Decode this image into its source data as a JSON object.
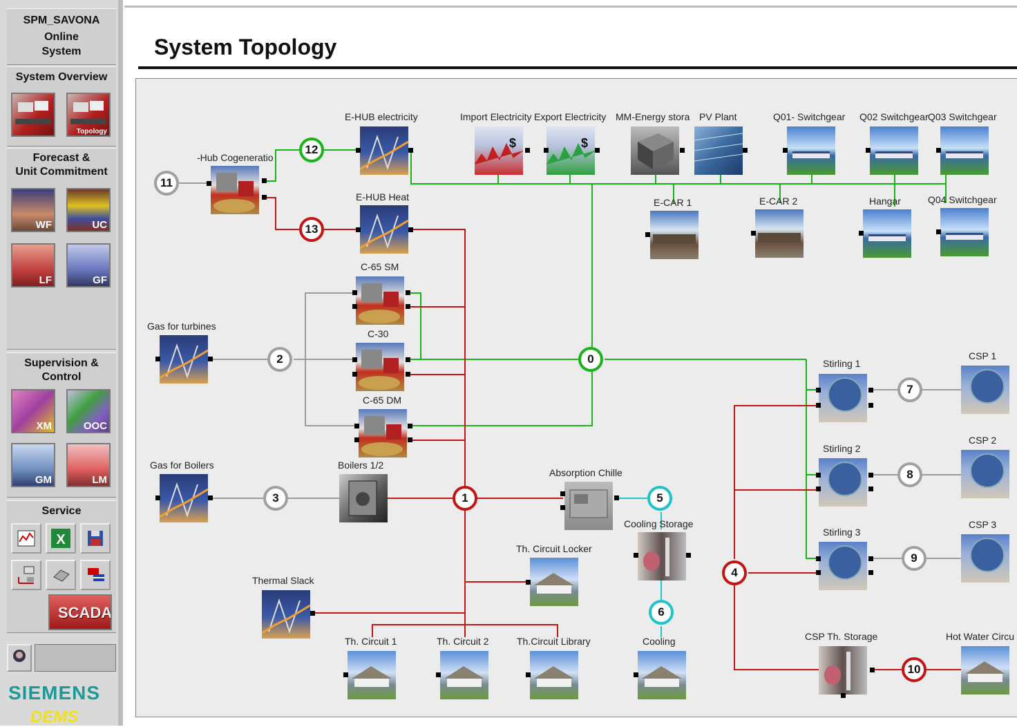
{
  "sidebar": {
    "system_name": "SPM_SAVONA",
    "system_subtitle_1": "Online",
    "system_subtitle_2": "System",
    "overview_label": "System Overview",
    "topology_caption": "Topology",
    "forecast_label_1": "Forecast &",
    "forecast_label_2": "Unit Commitment",
    "forecast_buttons": [
      "WF",
      "UC",
      "LF",
      "GF"
    ],
    "supervision_label_1": "Supervision &",
    "supervision_label_2": "Control",
    "supervision_buttons": [
      "XM",
      "OOC",
      "GM",
      "LM"
    ],
    "service_label": "Service",
    "scada_label": "SCADA",
    "brand": "SIEMENS",
    "brand_product": "DEMS"
  },
  "page": {
    "title": "System Topology"
  },
  "topology": {
    "labels": {
      "hub_cogen": "-Hub Cogeneratio",
      "ehub_electricity": "E-HUB electricity",
      "ehub_heat": "E-HUB Heat",
      "import_electricity": "Import Electricity",
      "export_electricity": "Export Electricity",
      "energy_storage": "MM-Energy stora",
      "pv_plant": "PV Plant",
      "q01": "Q01- Switchgear",
      "q02": "Q02 Switchgear",
      "q03": "Q03 Switchgear",
      "ecar1": "E-CAR 1",
      "ecar2": "E-CAR 2",
      "hangar": "Hangar",
      "q04": "Q04 Switchgear",
      "c65sm": "C-65 SM",
      "c30": "C-30",
      "c65dm": "C-65 DM",
      "gas_turbines": "Gas for turbines",
      "gas_boilers": "Gas for Boilers",
      "boilers": "Boilers 1/2",
      "absorption_chiller": "Absorption Chille",
      "cooling_storage": "Cooling Storage",
      "circuit_locker": "Th. Circuit Locker",
      "thermal_slack": "Thermal Slack",
      "th_circuit1": "Th. Circuit 1",
      "th_circuit2": "Th. Circuit 2",
      "th_circuit_library": "Th.Circuit Library",
      "cooling": "Cooling",
      "stirling1": "Stirling 1",
      "stirling2": "Stirling 2",
      "stirling3": "Stirling 3",
      "csp1": "CSP 1",
      "csp2": "CSP 2",
      "csp3": "CSP 3",
      "csp_storage": "CSP Th. Storage",
      "hot_water": "Hot Water Circu"
    },
    "nodes": {
      "n0": "0",
      "n1": "1",
      "n2": "2",
      "n3": "3",
      "n4": "4",
      "n5": "5",
      "n6": "6",
      "n7": "7",
      "n8": "8",
      "n9": "9",
      "n10": "10",
      "n11": "11",
      "n12": "12",
      "n13": "13"
    },
    "colors": {
      "electric": "#19b319",
      "thermal": "#c41414",
      "gas": "#9a9a9a",
      "cooling": "#1fc3c8"
    }
  }
}
